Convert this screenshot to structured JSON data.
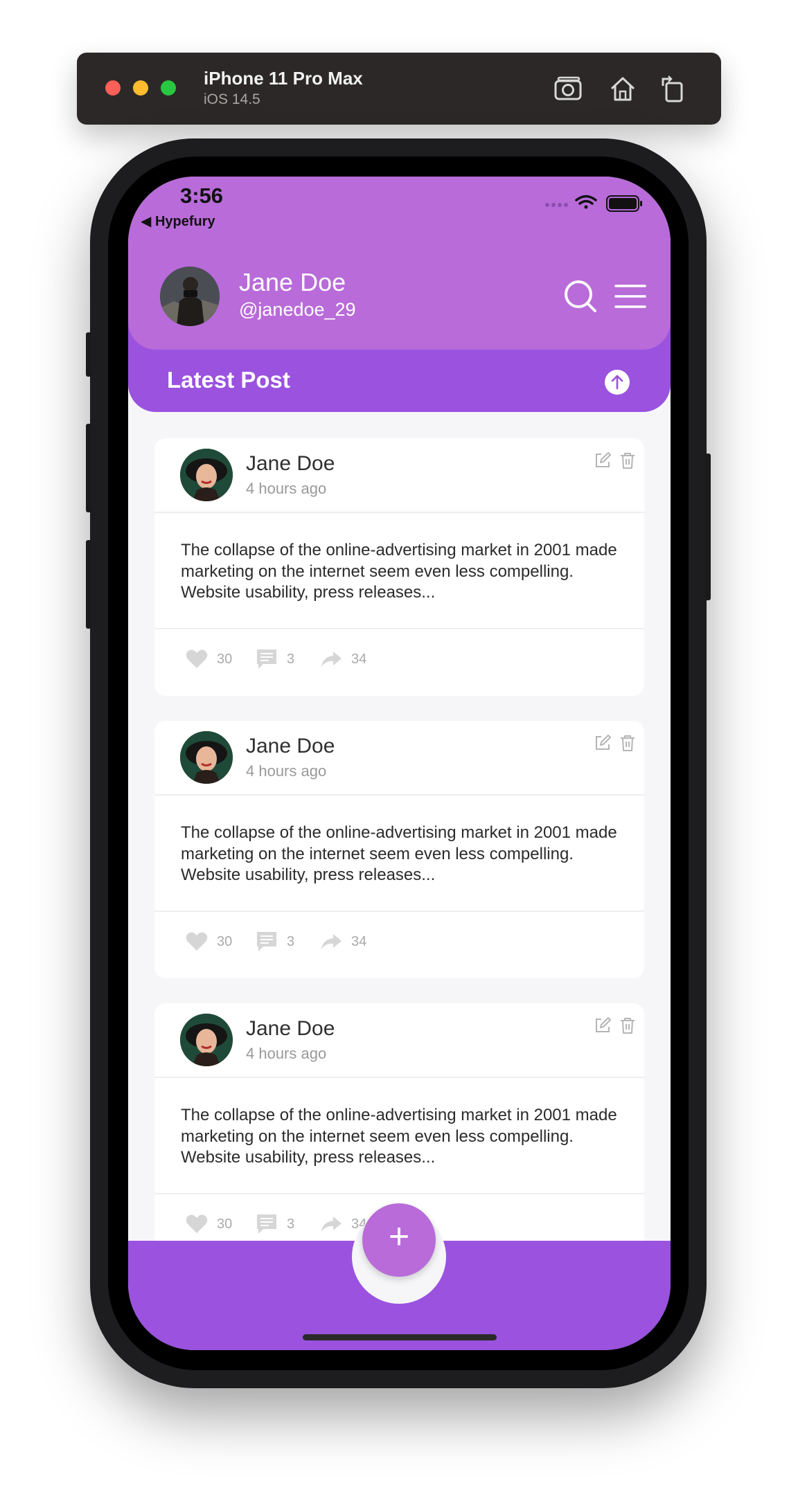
{
  "simulator": {
    "device": "iPhone 11 Pro Max",
    "os": "iOS 14.5",
    "icons": [
      "camera-icon",
      "home-icon",
      "rotate-icon"
    ]
  },
  "status_bar": {
    "time": "3:56",
    "back_label": "◀ Hypefury"
  },
  "profile": {
    "name": "Jane Doe",
    "handle": "@janedoe_29"
  },
  "section": {
    "title": "Latest Post"
  },
  "posts": [
    {
      "author": "Jane Doe",
      "time": "4 hours ago",
      "text": "The collapse of the online-advertising market in 2001 made marketing on the internet seem even less compelling. Website usability, press releases...",
      "likes": "30",
      "comments": "3",
      "shares": "34"
    },
    {
      "author": "Jane Doe",
      "time": "4 hours ago",
      "text": "The collapse of the online-advertising market in 2001 made marketing on the internet seem even less compelling. Website usability, press releases...",
      "likes": "30",
      "comments": "3",
      "shares": "34"
    },
    {
      "author": "Jane Doe",
      "time": "4 hours ago",
      "text": "The collapse of the online-advertising market in 2001 made marketing on the internet seem even less compelling. Website usability, press releases...",
      "likes": "30",
      "comments": "3",
      "shares": "34"
    }
  ],
  "fab": {
    "label": "+"
  },
  "colors": {
    "header": "#b86bd9",
    "accent": "#9a52df",
    "background": "#f6f6f9"
  }
}
